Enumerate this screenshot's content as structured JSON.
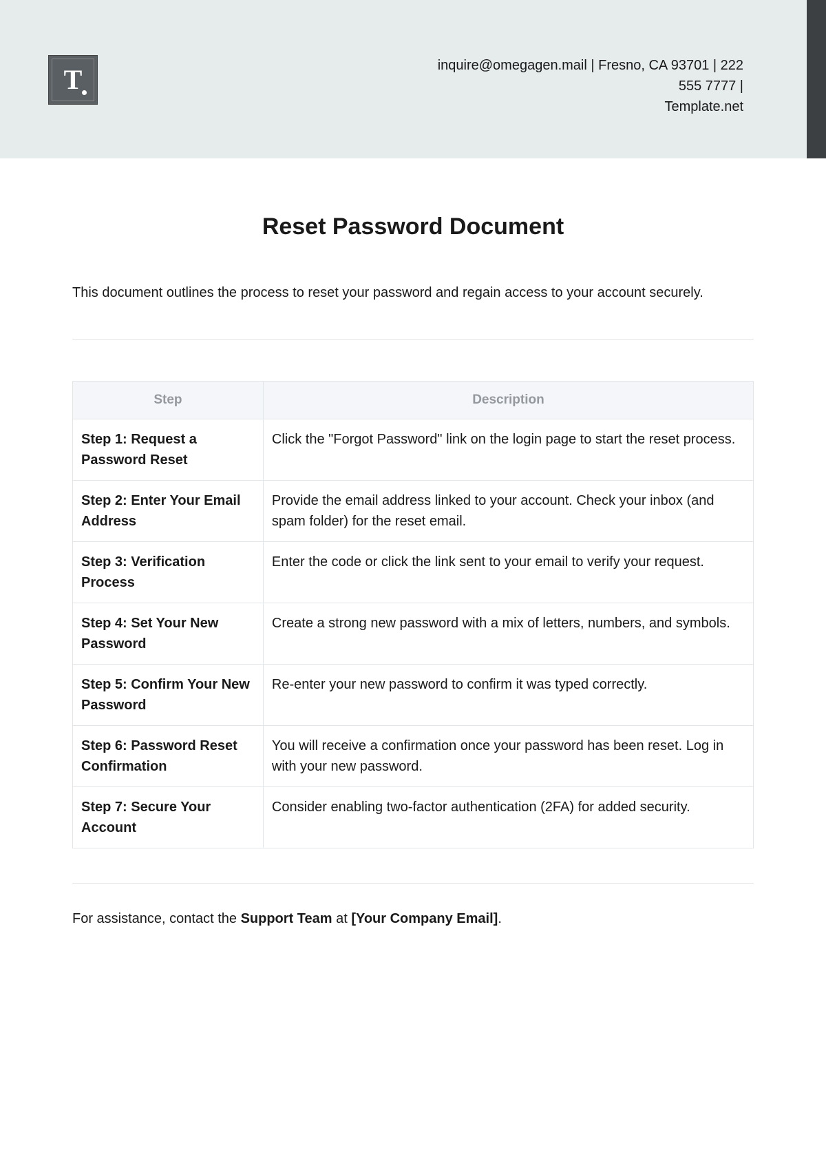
{
  "header": {
    "contact_line1": "inquire@omegagen.mail | Fresno, CA 93701 | 222 555 7777 |",
    "contact_line2": "Template.net",
    "logo_letter": "T"
  },
  "document": {
    "title": "Reset Password Document",
    "intro": "This document outlines the process to reset your password and regain access to your account securely."
  },
  "table": {
    "headers": {
      "step": "Step",
      "description": "Description"
    },
    "rows": [
      {
        "step": "Step 1: Request a Password Reset",
        "desc": "Click the \"Forgot Password\" link on the login page to start the reset process."
      },
      {
        "step": "Step 2: Enter Your Email Address",
        "desc": "Provide the email address linked to your account. Check your inbox (and spam folder) for the reset email."
      },
      {
        "step": "Step 3: Verification Process",
        "desc": "Enter the code or click the link sent to your email to verify your request."
      },
      {
        "step": "Step 4: Set Your New Password",
        "desc": "Create a strong new password with a mix of letters, numbers, and symbols."
      },
      {
        "step": "Step 5: Confirm Your New Password",
        "desc": "Re-enter your new password to confirm it was typed correctly."
      },
      {
        "step": "Step 6: Password Reset Confirmation",
        "desc": "You will receive a confirmation once your password has been reset. Log in with your new password."
      },
      {
        "step": "Step 7: Secure Your Account",
        "desc": "Consider enabling two-factor authentication (2FA) for added security."
      }
    ]
  },
  "footer": {
    "prefix": "For assistance, contact the ",
    "support": "Support Team",
    "mid": " at ",
    "email": "[Your Company Email]",
    "suffix": "."
  }
}
